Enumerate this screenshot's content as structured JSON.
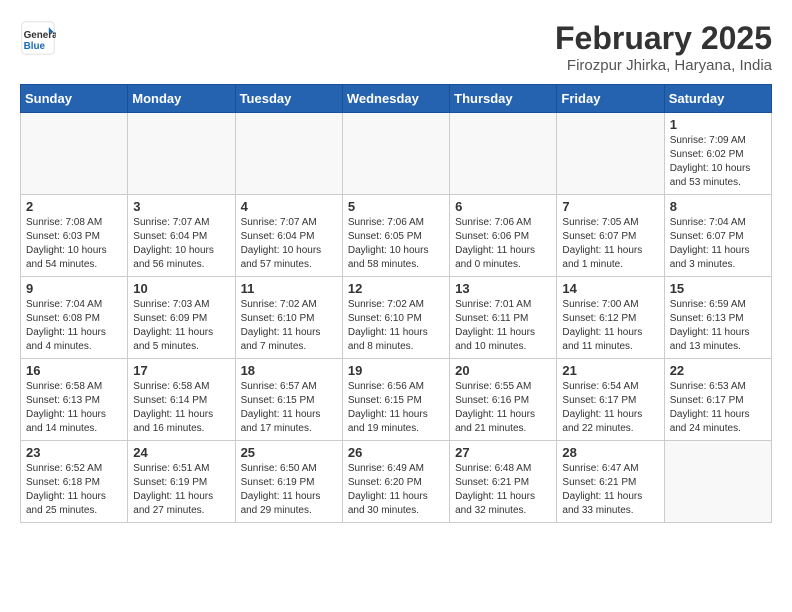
{
  "logo": {
    "line1": "General",
    "line2": "Blue"
  },
  "title": "February 2025",
  "subtitle": "Firozpur Jhirka, Haryana, India",
  "days_of_week": [
    "Sunday",
    "Monday",
    "Tuesday",
    "Wednesday",
    "Thursday",
    "Friday",
    "Saturday"
  ],
  "weeks": [
    [
      {
        "day": "",
        "info": ""
      },
      {
        "day": "",
        "info": ""
      },
      {
        "day": "",
        "info": ""
      },
      {
        "day": "",
        "info": ""
      },
      {
        "day": "",
        "info": ""
      },
      {
        "day": "",
        "info": ""
      },
      {
        "day": "1",
        "info": "Sunrise: 7:09 AM\nSunset: 6:02 PM\nDaylight: 10 hours\nand 53 minutes."
      }
    ],
    [
      {
        "day": "2",
        "info": "Sunrise: 7:08 AM\nSunset: 6:03 PM\nDaylight: 10 hours\nand 54 minutes."
      },
      {
        "day": "3",
        "info": "Sunrise: 7:07 AM\nSunset: 6:04 PM\nDaylight: 10 hours\nand 56 minutes."
      },
      {
        "day": "4",
        "info": "Sunrise: 7:07 AM\nSunset: 6:04 PM\nDaylight: 10 hours\nand 57 minutes."
      },
      {
        "day": "5",
        "info": "Sunrise: 7:06 AM\nSunset: 6:05 PM\nDaylight: 10 hours\nand 58 minutes."
      },
      {
        "day": "6",
        "info": "Sunrise: 7:06 AM\nSunset: 6:06 PM\nDaylight: 11 hours\nand 0 minutes."
      },
      {
        "day": "7",
        "info": "Sunrise: 7:05 AM\nSunset: 6:07 PM\nDaylight: 11 hours\nand 1 minute."
      },
      {
        "day": "8",
        "info": "Sunrise: 7:04 AM\nSunset: 6:07 PM\nDaylight: 11 hours\nand 3 minutes."
      }
    ],
    [
      {
        "day": "9",
        "info": "Sunrise: 7:04 AM\nSunset: 6:08 PM\nDaylight: 11 hours\nand 4 minutes."
      },
      {
        "day": "10",
        "info": "Sunrise: 7:03 AM\nSunset: 6:09 PM\nDaylight: 11 hours\nand 5 minutes."
      },
      {
        "day": "11",
        "info": "Sunrise: 7:02 AM\nSunset: 6:10 PM\nDaylight: 11 hours\nand 7 minutes."
      },
      {
        "day": "12",
        "info": "Sunrise: 7:02 AM\nSunset: 6:10 PM\nDaylight: 11 hours\nand 8 minutes."
      },
      {
        "day": "13",
        "info": "Sunrise: 7:01 AM\nSunset: 6:11 PM\nDaylight: 11 hours\nand 10 minutes."
      },
      {
        "day": "14",
        "info": "Sunrise: 7:00 AM\nSunset: 6:12 PM\nDaylight: 11 hours\nand 11 minutes."
      },
      {
        "day": "15",
        "info": "Sunrise: 6:59 AM\nSunset: 6:13 PM\nDaylight: 11 hours\nand 13 minutes."
      }
    ],
    [
      {
        "day": "16",
        "info": "Sunrise: 6:58 AM\nSunset: 6:13 PM\nDaylight: 11 hours\nand 14 minutes."
      },
      {
        "day": "17",
        "info": "Sunrise: 6:58 AM\nSunset: 6:14 PM\nDaylight: 11 hours\nand 16 minutes."
      },
      {
        "day": "18",
        "info": "Sunrise: 6:57 AM\nSunset: 6:15 PM\nDaylight: 11 hours\nand 17 minutes."
      },
      {
        "day": "19",
        "info": "Sunrise: 6:56 AM\nSunset: 6:15 PM\nDaylight: 11 hours\nand 19 minutes."
      },
      {
        "day": "20",
        "info": "Sunrise: 6:55 AM\nSunset: 6:16 PM\nDaylight: 11 hours\nand 21 minutes."
      },
      {
        "day": "21",
        "info": "Sunrise: 6:54 AM\nSunset: 6:17 PM\nDaylight: 11 hours\nand 22 minutes."
      },
      {
        "day": "22",
        "info": "Sunrise: 6:53 AM\nSunset: 6:17 PM\nDaylight: 11 hours\nand 24 minutes."
      }
    ],
    [
      {
        "day": "23",
        "info": "Sunrise: 6:52 AM\nSunset: 6:18 PM\nDaylight: 11 hours\nand 25 minutes."
      },
      {
        "day": "24",
        "info": "Sunrise: 6:51 AM\nSunset: 6:19 PM\nDaylight: 11 hours\nand 27 minutes."
      },
      {
        "day": "25",
        "info": "Sunrise: 6:50 AM\nSunset: 6:19 PM\nDaylight: 11 hours\nand 29 minutes."
      },
      {
        "day": "26",
        "info": "Sunrise: 6:49 AM\nSunset: 6:20 PM\nDaylight: 11 hours\nand 30 minutes."
      },
      {
        "day": "27",
        "info": "Sunrise: 6:48 AM\nSunset: 6:21 PM\nDaylight: 11 hours\nand 32 minutes."
      },
      {
        "day": "28",
        "info": "Sunrise: 6:47 AM\nSunset: 6:21 PM\nDaylight: 11 hours\nand 33 minutes."
      },
      {
        "day": "",
        "info": ""
      }
    ]
  ]
}
